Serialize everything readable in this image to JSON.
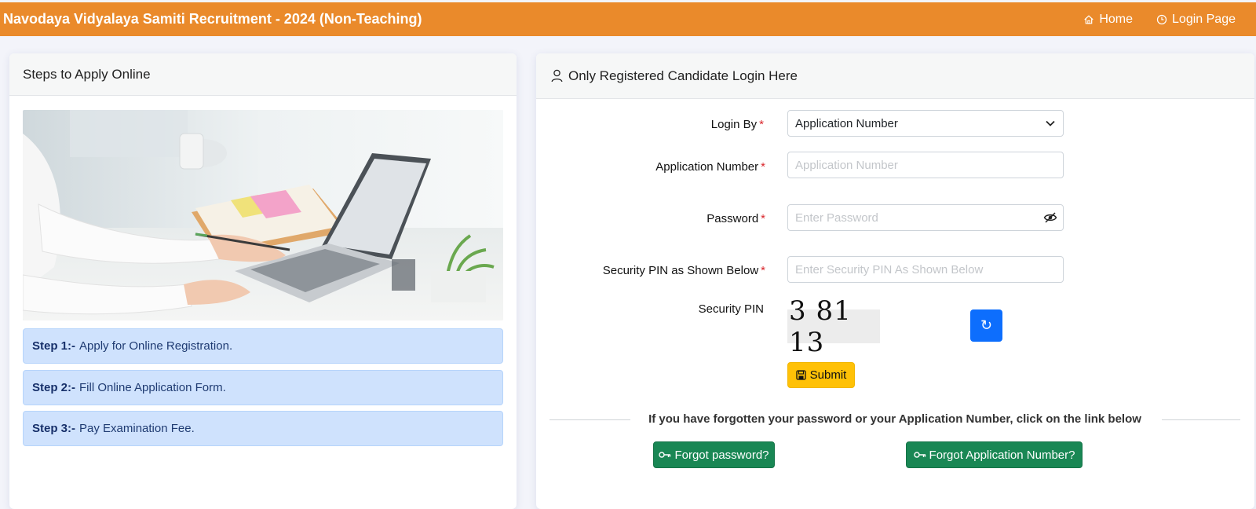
{
  "header": {
    "title": "Navodaya Vidyalaya Samiti Recruitment - 2024 (Non-Teaching)",
    "nav": [
      {
        "label": "Home",
        "icon": "home-icon"
      },
      {
        "label": "Login Page",
        "icon": "clock-icon"
      }
    ],
    "color": "#ea8a2b"
  },
  "left_panel": {
    "title": "Steps to Apply Online",
    "steps": [
      {
        "label": "Step 1:-",
        "text": "Apply for Online Registration."
      },
      {
        "label": "Step 2:-",
        "text": "Fill Online Application Form."
      },
      {
        "label": "Step 3:-",
        "text": "Pay Examination Fee."
      }
    ]
  },
  "login_panel": {
    "title": "Only Registered Candidate Login Here",
    "login_by": {
      "label": "Login By",
      "value": "Application Number"
    },
    "application_number": {
      "label": "Application Number",
      "placeholder": "Application Number"
    },
    "password": {
      "label": "Password",
      "placeholder": "Enter Password"
    },
    "security_pin_input": {
      "label": "Security PIN as Shown Below",
      "placeholder": "Enter Security PIN As Shown Below"
    },
    "security_pin": {
      "label": "Security PIN",
      "captcha": "3 81 13"
    },
    "refresh_symbol": "↻",
    "submit_label": "Submit",
    "forgot_text": "If you have forgotten your password or your Application Number, click on the link below",
    "forgot_password_label": "Forgot password?",
    "forgot_application_label": "Forgot Application Number?",
    "required_marker": "*"
  }
}
